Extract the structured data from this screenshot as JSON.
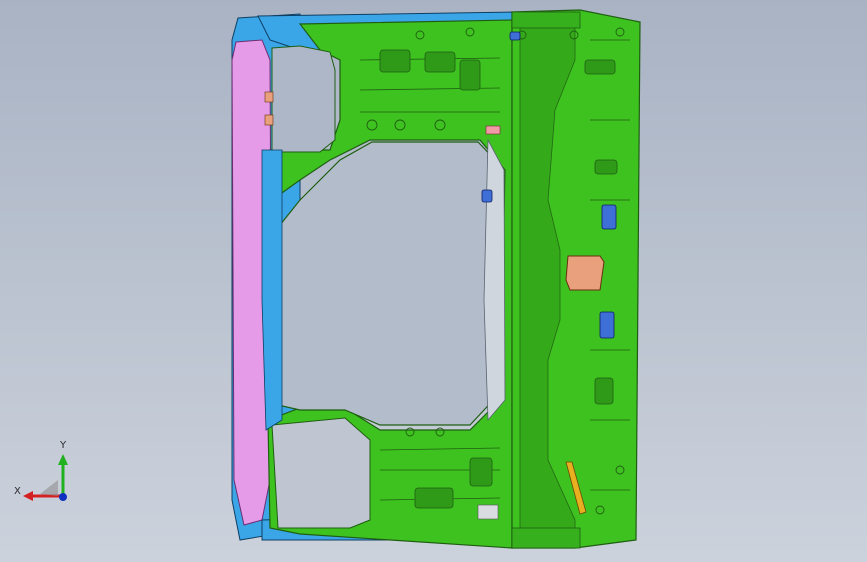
{
  "viewport": {
    "background_top": "#a9b3c4",
    "background_bottom": "#ccd2dc"
  },
  "model": {
    "colors": {
      "floor": "#3ec21f",
      "floor_dark": "#1f7a12",
      "side_rail": "#3aa6e8",
      "outer_panel": "#e59be8",
      "bracket": "#e9a07c",
      "clip": "#3d6fd6"
    },
    "parts": [
      "floor-panel",
      "left-side-rail",
      "outer-sill-panel",
      "rear-tunnel",
      "cross-member-bracket",
      "mounting-clips"
    ]
  },
  "triad": {
    "x_label": "X",
    "y_label": "Y",
    "x_color": "#d42020",
    "y_color": "#20b020",
    "z_color": "#1030c0"
  }
}
